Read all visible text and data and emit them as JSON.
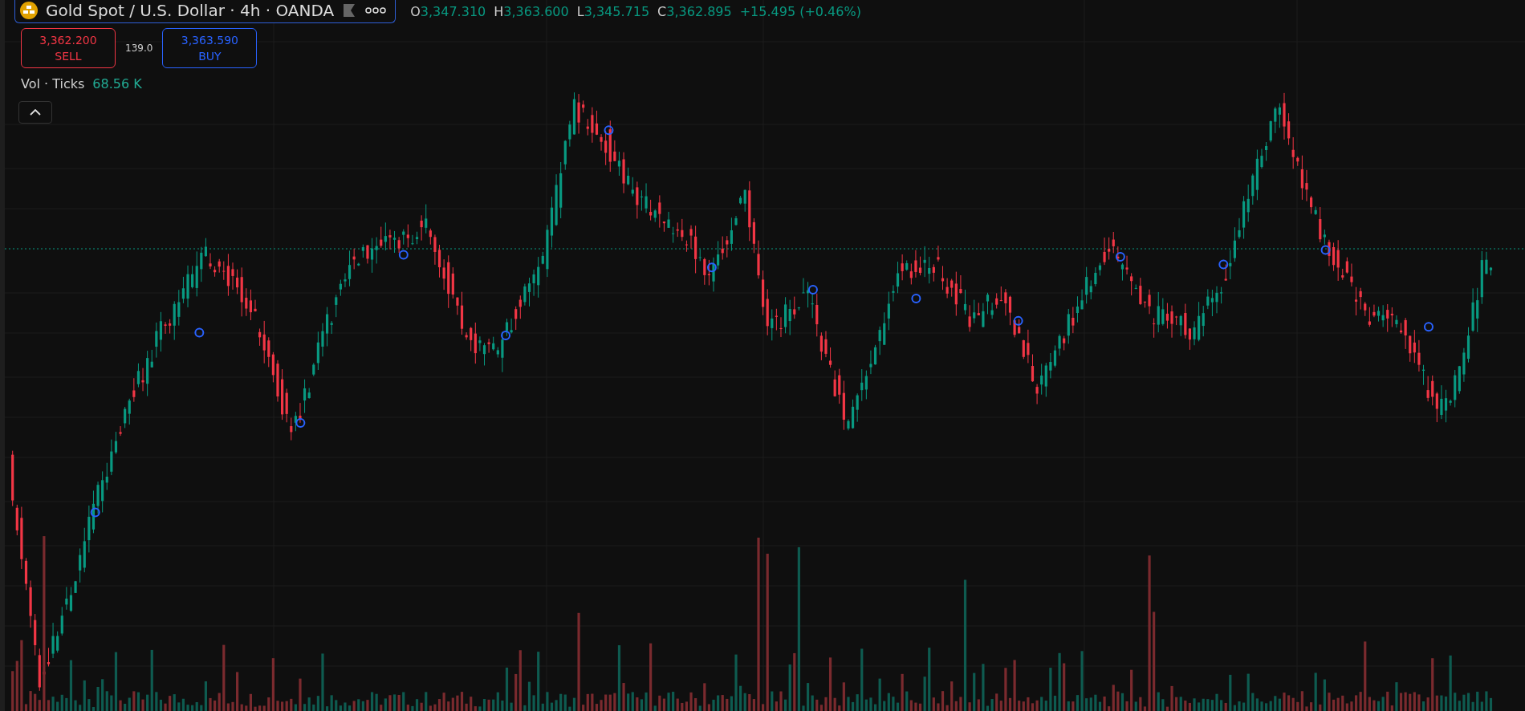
{
  "symbol": {
    "title": "Gold Spot / U.S. Dollar · 4h · OANDA"
  },
  "ohlc": [
    {
      "label": "O",
      "value": "3,347.310"
    },
    {
      "label": "H",
      "value": "3,363.600"
    },
    {
      "label": "L",
      "value": "3,345.715"
    },
    {
      "label": "C",
      "value": "3,362.895"
    }
  ],
  "change": "+15.495 (+0.46%)",
  "trade": {
    "sell": {
      "price": "3,362.200",
      "label": "SELL"
    },
    "spread": "139.0",
    "buy": {
      "price": "3,363.590",
      "label": "BUY"
    }
  },
  "volume": {
    "label": "Vol · Ticks",
    "value": "68.56 K"
  }
}
